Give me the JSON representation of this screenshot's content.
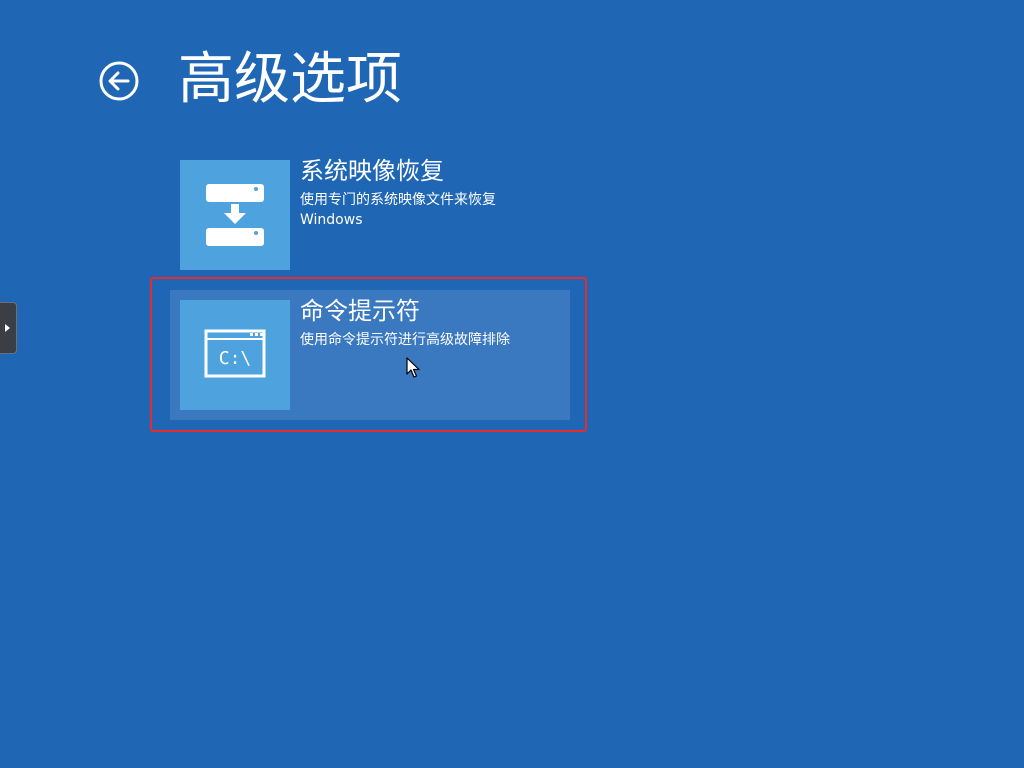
{
  "page": {
    "title": "高级选项",
    "background_color": "#1f66b5"
  },
  "back_button": {
    "icon": "back-arrow-circle-icon"
  },
  "options": [
    {
      "title": "系统映像恢复",
      "description": "使用专门的系统映像文件来恢复 Windows",
      "icon": "drive-download-icon",
      "selected": false
    },
    {
      "title": "命令提示符",
      "description": "使用命令提示符进行高级故障排除",
      "icon": "command-prompt-icon",
      "icon_text": "C:\\",
      "selected": true
    }
  ],
  "colors": {
    "tile": "#4ea3df",
    "selected_background": "#3a78c0",
    "highlight_border": "#e52b2b"
  }
}
